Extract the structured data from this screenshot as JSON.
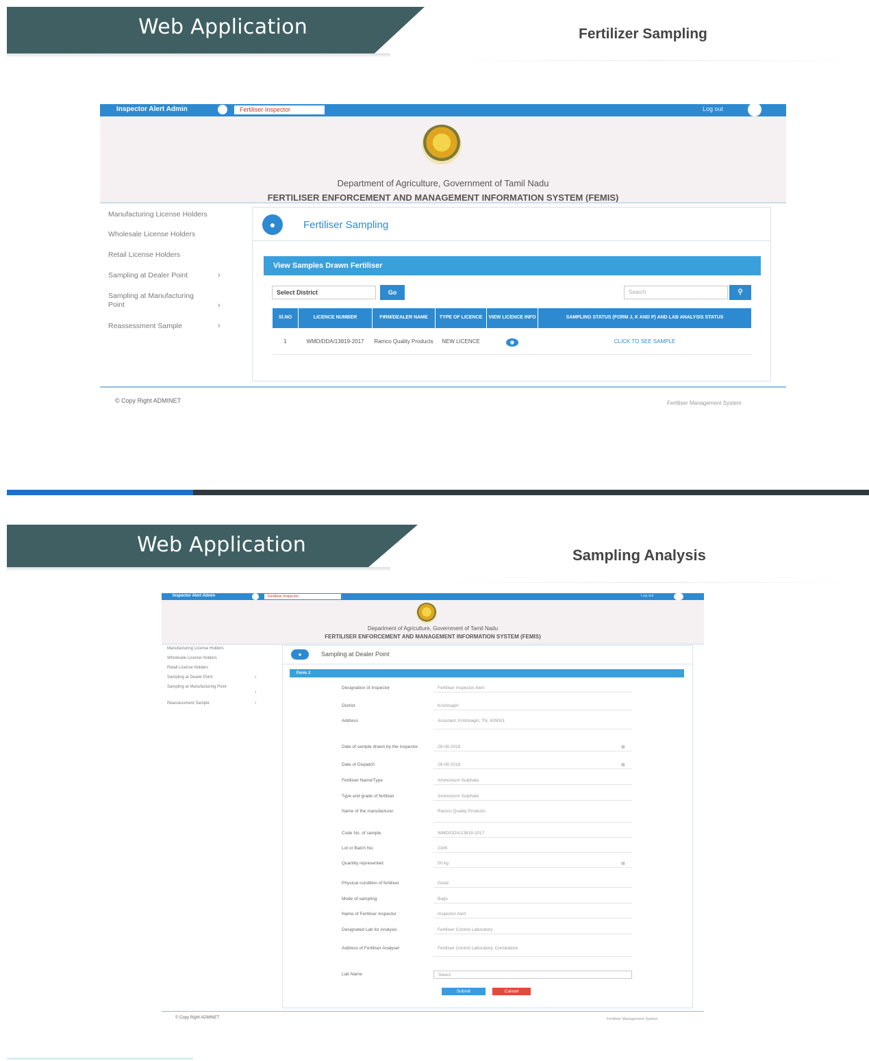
{
  "slides": [
    {
      "banner_title": "Web Application",
      "subtitle": "Fertilizer Sampling"
    },
    {
      "banner_title": "Web Application",
      "subtitle": "Sampling Analysis"
    }
  ],
  "app1": {
    "topbar": {
      "user": "Inspector Alert Admin",
      "tab": "Fertiliser Inspector",
      "right": "Log out"
    },
    "header": {
      "department": "Department of Agriculture, Government of Tamil Nadu",
      "system": "FERTILISER ENFORCEMENT AND MANAGEMENT INFORMATION SYSTEM (FEMIS)"
    },
    "sidebar": [
      {
        "label": "Manufacturing License Holders",
        "arrow": ""
      },
      {
        "label": "Wholesale License Holders",
        "arrow": ""
      },
      {
        "label": "Retail License Holders",
        "arrow": ""
      },
      {
        "label": "Sampling at Dealer Point",
        "arrow": "›"
      },
      {
        "label": "Sampling at Manufacturing",
        "label2": "Point",
        "arrow": "›"
      },
      {
        "label": "Reassessment Sample",
        "arrow": "›"
      }
    ],
    "panel_title": "Fertiliser Sampling",
    "section_title": "View Samples Drawn Fertiliser",
    "district_select": "Select District",
    "go_label": "Go",
    "search_placeholder": "Search",
    "table": {
      "headers": [
        "Sl.NO",
        "LICENCE NUMBER",
        "FIRM/DEALER NAME",
        "TYPE OF LICENCE",
        "VIEW LICENCE INFO",
        "SAMPLING STATUS (FORM J, K AND P) AND LAB ANALYSIS STATUS"
      ],
      "rows": [
        [
          "1",
          "WMD/DDA/13819-2017",
          "Ramco Quality Products",
          "NEW LICENCE",
          "",
          "CLICK TO SEE SAMPLE"
        ]
      ]
    },
    "footer_left": "© Copy Right ADMINET",
    "footer_right": "Fertiliser Management System"
  },
  "app2": {
    "topbar": {
      "user": "Inspector Alert Admin",
      "tab": "Fertiliser Inspector",
      "right": "Log out"
    },
    "header": {
      "department": "Department of Agriculture, Government of Tamil Nadu",
      "system": "FERTILISER ENFORCEMENT AND MANAGEMENT INFORMATION SYSTEM (FEMIS)"
    },
    "sidebar": [
      {
        "label": "Manufacturing License Holders",
        "arrow": ""
      },
      {
        "label": "Wholesale License Holders",
        "arrow": ""
      },
      {
        "label": "Retail License Holders",
        "arrow": ""
      },
      {
        "label": "Sampling at Dealer Point",
        "arrow": "›"
      },
      {
        "label": "Sampling at Manufacturing Point",
        "arrow": "›"
      },
      {
        "label": "Reassessment Sample",
        "arrow": "›"
      }
    ],
    "panel_title": "Sampling at Dealer Point",
    "section_title": "Form J",
    "form_rows": [
      {
        "label": "Designation of Inspector",
        "value": "Fertiliser Inspector Alert"
      },
      {
        "label": "District",
        "value": "Krishnagiri"
      },
      {
        "label": "Address",
        "value": "Assistant, Krishnagiri, TN, 635001"
      },
      {
        "label": "Date of sample drawn by the Inspector",
        "value": "28-08-2018"
      },
      {
        "label": "Date of Dispatch",
        "value": "28-08-2018"
      },
      {
        "label": "Fertiliser Name/Type",
        "value": "Ammonium Sulphate"
      },
      {
        "label": "Type and grade of fertiliser",
        "value": "Ammonium Sulphate"
      },
      {
        "label": "Name of the manufacturer",
        "value": "Ramco Quality Products"
      },
      {
        "label": "Code No. of sample",
        "value": "WMD/DDA/13819-2017"
      },
      {
        "label": "Lot or Batch No.",
        "value": "2345"
      },
      {
        "label": "Quantity represented",
        "value": "50 kg"
      },
      {
        "label": "Physical condition of fertiliser",
        "value": "Good"
      },
      {
        "label": "Mode of sampling",
        "value": "Bags"
      },
      {
        "label": "Name of Fertiliser Inspector",
        "value": "Inspector Alert"
      },
      {
        "label": "Designated Lab for Analysis",
        "value": "Fertiliser Control Laboratory"
      },
      {
        "label": "Address of Fertiliser Analyser",
        "value": "Fertiliser Control Laboratory, Coimbatore"
      },
      {
        "label": "Lab Name",
        "value": "Select"
      }
    ],
    "submit_label": "Submit",
    "cancel_label": "Cancel",
    "footer_left": "© Copy Right ADMINET",
    "footer_right": "Fertiliser Management System"
  },
  "colors": {
    "banner": "#3f5f63",
    "primary": "#2e8ad0",
    "section": "#3aa0dc",
    "cancel": "#e24b3a"
  },
  "icons": {
    "user_badge": "user-icon",
    "panel": "user-group-icon",
    "search": "search-icon",
    "view": "eye-icon"
  }
}
